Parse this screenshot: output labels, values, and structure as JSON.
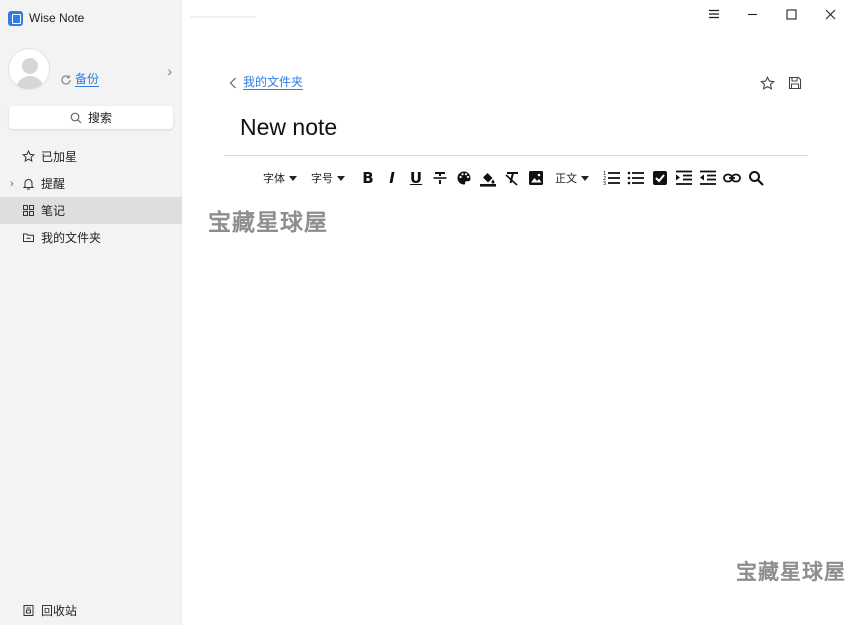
{
  "app": {
    "title": "Wise Note"
  },
  "profile": {
    "backup_label": "备份"
  },
  "search": {
    "label": "搜索"
  },
  "nav": {
    "items": [
      {
        "label": "已加星"
      },
      {
        "label": "提醒"
      },
      {
        "label": "笔记"
      },
      {
        "label": "我的文件夹"
      }
    ],
    "trash_label": "回收站"
  },
  "main": {
    "back_label": "我的文件夹",
    "note_title": "New note"
  },
  "toolbar": {
    "font_label": "字体",
    "size_label": "字号",
    "paragraph_label": "正文",
    "bold_label": "B",
    "italic_label": "I",
    "underline_label": "U"
  },
  "watermark": {
    "text": "宝藏星球屋",
    "text2": "宝藏星球屋"
  },
  "colors": {
    "accent": "#2f7de1",
    "sidebar": "#f3f3f3",
    "active": "#dedede"
  }
}
